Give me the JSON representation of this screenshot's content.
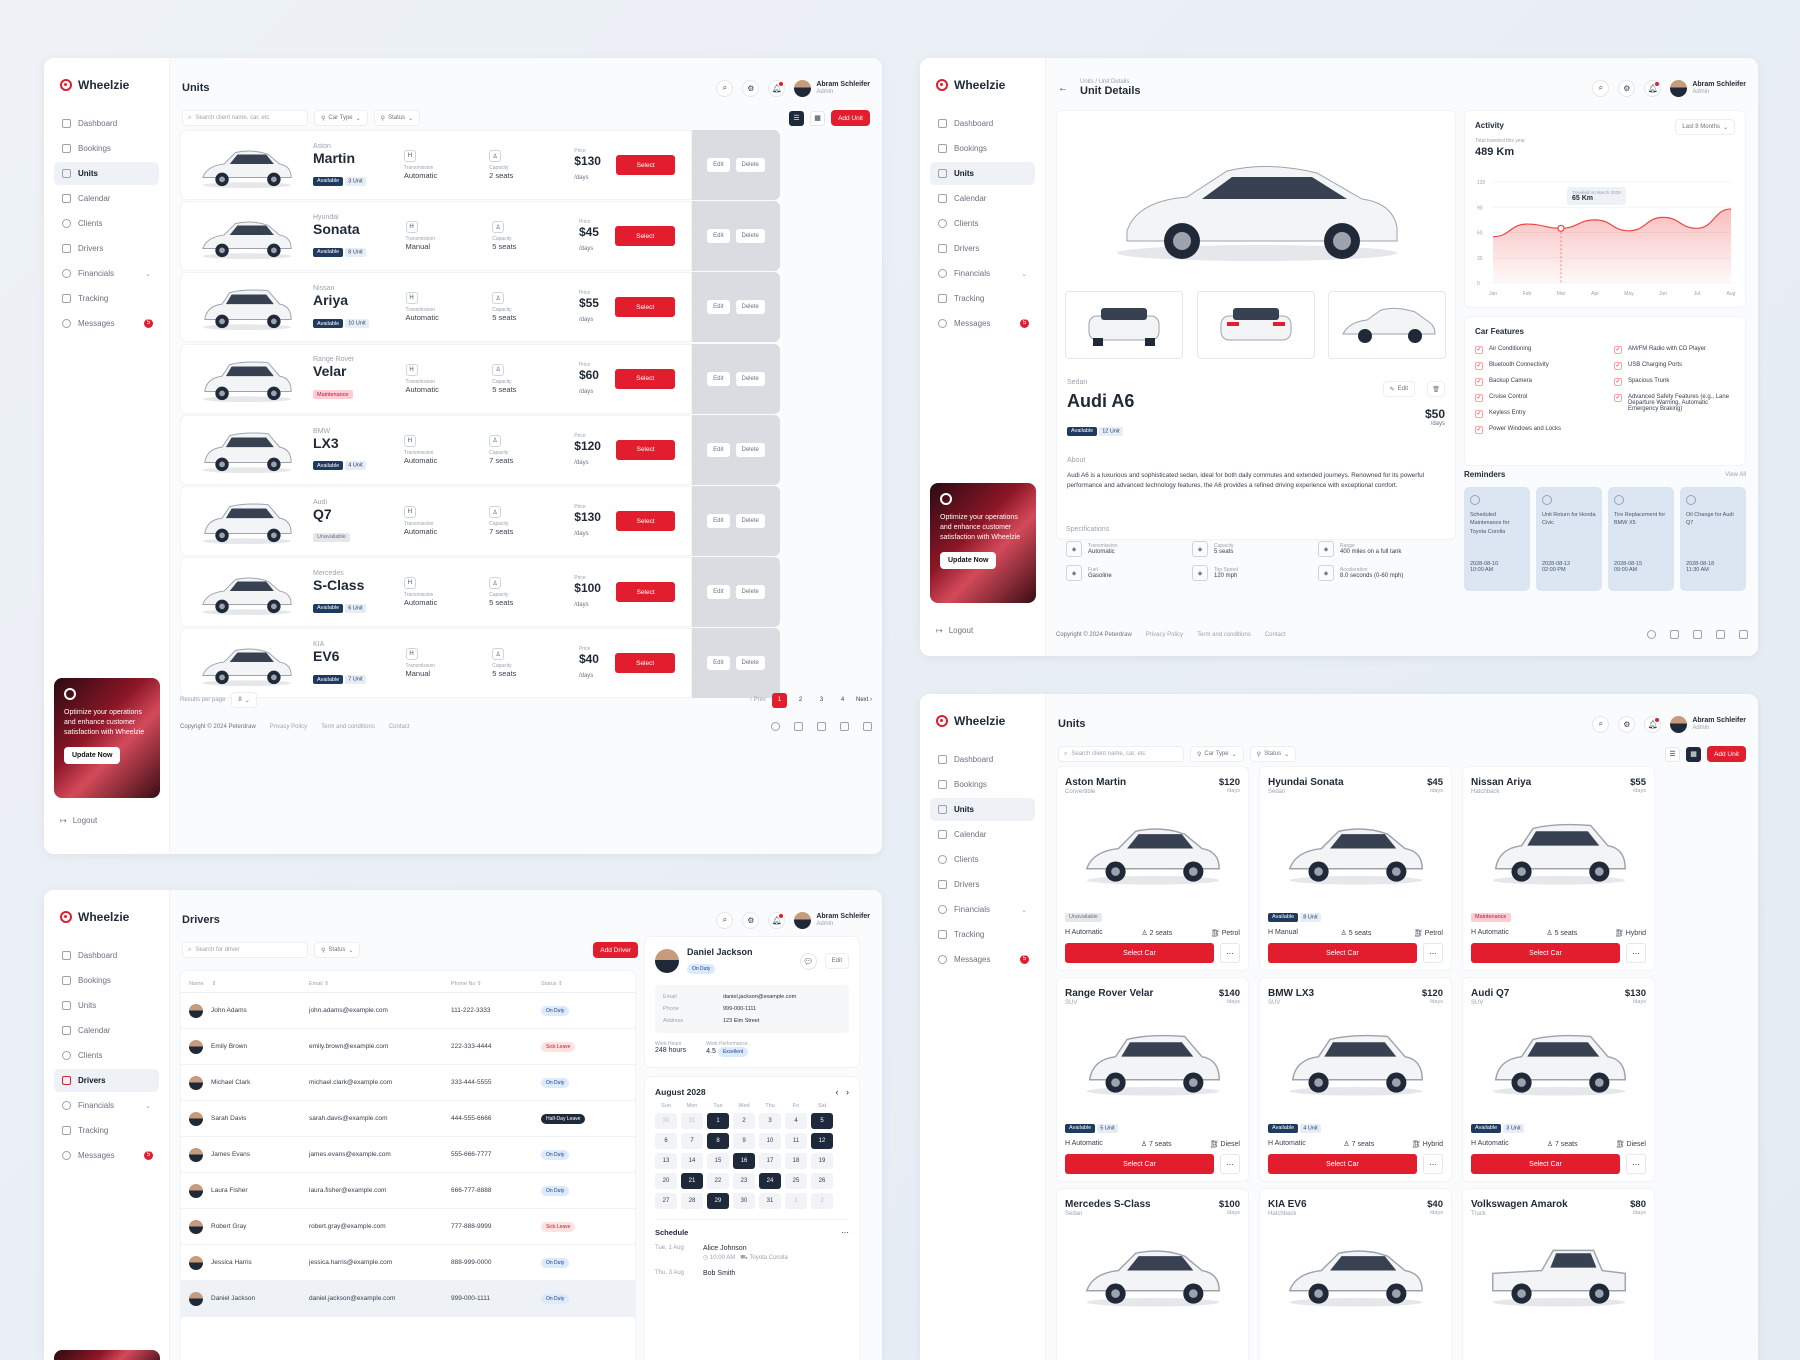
{
  "brand": "Wheelzie",
  "nav": {
    "dashboard": "Dashboard",
    "bookings": "Bookings",
    "units": "Units",
    "calendar": "Calendar",
    "clients": "Clients",
    "drivers": "Drivers",
    "financials": "Financials",
    "tracking": "Tracking",
    "messages": "Messages",
    "messages_count": "5"
  },
  "promo": {
    "text": "Optimize your operations and enhance customer satisfaction with Wheelzie",
    "button": "Update Now"
  },
  "logout": "Logout",
  "user": {
    "name": "Abram Schleifer",
    "role": "Admin"
  },
  "units_page": {
    "title": "Units",
    "search_placeholder": "Search client name, car, etc",
    "filter_car_type": "Car Type",
    "filter_status": "Status",
    "add_button": "Add Unit",
    "select_label": "Select",
    "edit_label": "Edit",
    "delete_label": "Delete",
    "transmission_label": "Transmission",
    "capacity_label": "Capacity",
    "price_label": "Price",
    "per_day": "/days",
    "rows": [
      {
        "brand": "Aston",
        "model": "Martin",
        "status": "Available",
        "count": "3 Unit",
        "transmission": "Automatic",
        "capacity": "2 seats",
        "price": "$130"
      },
      {
        "brand": "Hyundai",
        "model": "Sonata",
        "status": "Available",
        "count": "8 Unit",
        "transmission": "Manual",
        "capacity": "5 seats",
        "price": "$45"
      },
      {
        "brand": "Nissan",
        "model": "Ariya",
        "status": "Available",
        "count": "10 Unit",
        "transmission": "Automatic",
        "capacity": "5 seats",
        "price": "$55"
      },
      {
        "brand": "Range Rover",
        "model": "Velar",
        "status": "Maintenance",
        "count": "",
        "transmission": "Automatic",
        "capacity": "5 seats",
        "price": "$60"
      },
      {
        "brand": "BMW",
        "model": "LX3",
        "status": "Available",
        "count": "4 Unit",
        "transmission": "Automatic",
        "capacity": "7 seats",
        "price": "$120"
      },
      {
        "brand": "Audi",
        "model": "Q7",
        "status": "Unavailable",
        "count": "",
        "transmission": "Automatic",
        "capacity": "7 seats",
        "price": "$130"
      },
      {
        "brand": "Mercedes",
        "model": "S-Class",
        "status": "Available",
        "count": "6 Unit",
        "transmission": "Automatic",
        "capacity": "5 seats",
        "price": "$100"
      },
      {
        "brand": "KIA",
        "model": "EV6",
        "status": "Available",
        "count": "7 Unit",
        "transmission": "Manual",
        "capacity": "5 seats",
        "price": "$40"
      }
    ],
    "results_per_page_label": "Results per page",
    "results_per_page": "8",
    "prev": "Prev",
    "next": "Next",
    "pages": [
      "1",
      "2",
      "3",
      "4"
    ]
  },
  "footer": {
    "copyright": "Copyright © 2024 Peterdraw",
    "privacy": "Privacy Policy",
    "terms": "Term and conditions",
    "contact": "Contact"
  },
  "detail_page": {
    "breadcrumb_1": "Units",
    "breadcrumb_2": "Unit Details",
    "title": "Unit Details",
    "car_type": "Sedan",
    "car_name": "Audi A6",
    "status": "Available",
    "count": "12 Unit",
    "price": "$50",
    "per_day": "/days",
    "edit": "Edit",
    "about_label": "About",
    "about_text": "Audi A6 is a luxurious and sophisticated sedan, ideal for both daily commutes and extended journeys. Renowned for its powerful performance and advanced technology features, the A6 provides a refined driving experience with exceptional comfort.",
    "specs_label": "Specifications",
    "specs": [
      {
        "label": "Transmission",
        "value": "Automatic",
        "icon": "gear-shift-icon"
      },
      {
        "label": "Capacity",
        "value": "5 seats",
        "icon": "seat-icon"
      },
      {
        "label": "Range",
        "value": "400 miles on a full tank",
        "icon": "road-icon"
      },
      {
        "label": "Fuel",
        "value": "Gasoline",
        "icon": "fuel-icon"
      },
      {
        "label": "Top Speed",
        "value": "120 mph",
        "icon": "speedometer-icon"
      },
      {
        "label": "Acceleration",
        "value": "8.0 seconds (0-60 mph)",
        "icon": "gauge-icon"
      }
    ],
    "activity": {
      "title": "Activity",
      "range": "Last 8 Months",
      "subtitle": "Total traveled this year",
      "total": "489 Km",
      "tooltip_label": "Traveled on March 2028",
      "tooltip_value": "65 Km"
    },
    "features_title": "Car Features",
    "features_left": [
      "Air Conditioning",
      "Bluetooth Connectivity",
      "Backup Camera",
      "Cruise Control",
      "Keyless Entry",
      "Power Windows and Locks"
    ],
    "features_right": [
      "AM/FM Radio with CD Player",
      "USB Charging Ports",
      "Spacious Trunk",
      "Advanced Safety Features (e.g., Lane Departure Warning, Automatic Emergency Braking)"
    ],
    "reminders_title": "Reminders",
    "view_all": "View All",
    "reminders": [
      {
        "text": "Scheduled Maintenance for Toyota Corolla",
        "date": "2028-08-10",
        "time": "10:00 AM"
      },
      {
        "text": "Unit Return for Honda Civic",
        "date": "2028-08-12",
        "time": "02:00 PM"
      },
      {
        "text": "Tire Replacement for BMW X5",
        "date": "2028-08-15",
        "time": "09:00 AM"
      },
      {
        "text": "Oil Change for Audi Q7",
        "date": "2028-08-18",
        "time": "11:30 AM"
      }
    ]
  },
  "chart_data": {
    "type": "area",
    "title": "Activity",
    "categories": [
      "Jan",
      "Feb",
      "Mar",
      "Apr",
      "May",
      "Jun",
      "Jul",
      "Aug"
    ],
    "values": [
      55,
      70,
      65,
      75,
      62,
      78,
      65,
      88
    ],
    "yticks": [
      "120",
      "90",
      "60",
      "30",
      "0"
    ],
    "ylim": [
      0,
      120
    ],
    "highlight": {
      "category": "Mar",
      "value": 65
    }
  },
  "grid_page": {
    "title": "Units",
    "search_placeholder": "Search client name, car, etc",
    "filter_car_type": "Car Type",
    "filter_status": "Status",
    "add_button": "Add Unit",
    "select_label": "Select Car",
    "cards": [
      {
        "name": "Aston Martin",
        "type": "Convertible",
        "price": "$120",
        "status": "Unavailable",
        "count": "",
        "transmission": "Automatic",
        "seats": "2 seats",
        "fuel": "Petrol"
      },
      {
        "name": "Hyundai Sonata",
        "type": "Sedan",
        "price": "$45",
        "status": "Available",
        "count": "8 Unit",
        "transmission": "Manual",
        "seats": "5 seats",
        "fuel": "Petrol"
      },
      {
        "name": "Nissan Ariya",
        "type": "Hatchback",
        "price": "$55",
        "status": "Maintenance",
        "count": "",
        "transmission": "Automatic",
        "seats": "5 seats",
        "fuel": "Hybrid"
      },
      {
        "name": "Range Rover Velar",
        "type": "SUV",
        "price": "$140",
        "status": "Available",
        "count": "5 Unit",
        "transmission": "Automatic",
        "seats": "7 seats",
        "fuel": "Diesel"
      },
      {
        "name": "BMW LX3",
        "type": "SUV",
        "price": "$120",
        "status": "Available",
        "count": "4 Unit",
        "transmission": "Automatic",
        "seats": "7 seats",
        "fuel": "Hybrid"
      },
      {
        "name": "Audi Q7",
        "type": "SUV",
        "price": "$130",
        "status": "Available",
        "count": "3 Unit",
        "transmission": "Automatic",
        "seats": "7 seats",
        "fuel": "Diesel"
      },
      {
        "name": "Mercedes S-Class",
        "type": "Sedan",
        "price": "$100",
        "status": "",
        "count": "",
        "transmission": "",
        "seats": "",
        "fuel": ""
      },
      {
        "name": "KIA EV6",
        "type": "Hatchback",
        "price": "$40",
        "status": "",
        "count": "",
        "transmission": "",
        "seats": "",
        "fuel": ""
      },
      {
        "name": "Volkswagen Amarok",
        "type": "Truck",
        "price": "$80",
        "status": "",
        "count": "",
        "transmission": "",
        "seats": "",
        "fuel": ""
      }
    ],
    "per_day": "/days"
  },
  "drivers_page": {
    "title": "Drivers",
    "search_placeholder": "Search for driver",
    "filter_status": "Status",
    "add_button": "Add Driver",
    "headers": {
      "name": "Name",
      "email": "Email",
      "phone": "Phone No",
      "status": "Status"
    },
    "rows": [
      {
        "name": "John Adams",
        "email": "john.adams@example.com",
        "phone": "111-222-3333",
        "status": "On Duty"
      },
      {
        "name": "Emily Brown",
        "email": "emily.brown@example.com",
        "phone": "222-333-4444",
        "status": "Sick Leave"
      },
      {
        "name": "Michael Clark",
        "email": "michael.clark@example.com",
        "phone": "333-444-5555",
        "status": "On Duty"
      },
      {
        "name": "Sarah Davis",
        "email": "sarah.davis@example.com",
        "phone": "444-555-6666",
        "status": "Half-Day Leave"
      },
      {
        "name": "James Evans",
        "email": "james.evans@example.com",
        "phone": "555-666-7777",
        "status": "On Duty"
      },
      {
        "name": "Laura Fisher",
        "email": "laura.fisher@example.com",
        "phone": "666-777-8888",
        "status": "On Duty"
      },
      {
        "name": "Robert Gray",
        "email": "robert.gray@example.com",
        "phone": "777-888-9999",
        "status": "Sick Leave"
      },
      {
        "name": "Jessica Harris",
        "email": "jessica.harris@example.com",
        "phone": "888-999-0000",
        "status": "On Duty"
      },
      {
        "name": "Daniel Jackson",
        "email": "daniel.jackson@example.com",
        "phone": "999-000-1111",
        "status": "On Duty"
      }
    ],
    "detail": {
      "name": "Daniel Jackson",
      "status": "On Duty",
      "edit": "Edit",
      "email_label": "Email",
      "email": "daniel.jackson@example.com",
      "phone_label": "Phone",
      "phone": "999-000-1111",
      "address_label": "Address",
      "address": "123 Elm Street",
      "hours_label": "Work Hours",
      "hours": "248 hours",
      "perf_label": "Work Performance",
      "perf": "4.5",
      "perf_badge": "Excellent"
    },
    "calendar": {
      "month": "August 2028",
      "weekdays": [
        "Sun",
        "Mon",
        "Tue",
        "Wed",
        "Thu",
        "Fri",
        "Sat"
      ],
      "days": [
        "30",
        "31",
        "1",
        "2",
        "3",
        "4",
        "5",
        "6",
        "7",
        "8",
        "9",
        "10",
        "11",
        "12",
        "13",
        "14",
        "15",
        "16",
        "17",
        "18",
        "19",
        "20",
        "21",
        "22",
        "23",
        "24",
        "25",
        "26",
        "27",
        "28",
        "29",
        "30",
        "31",
        "1",
        "2"
      ]
    },
    "schedule": {
      "title": "Schedule",
      "items": [
        {
          "date": "Tue, 1 Aug",
          "name": "Alice Johnson",
          "time": "10:00 AM",
          "car": "Toyota Corolla"
        },
        {
          "date": "Thu, 3 Aug",
          "name": "Bob Smith",
          "time": "",
          "car": ""
        }
      ]
    }
  }
}
